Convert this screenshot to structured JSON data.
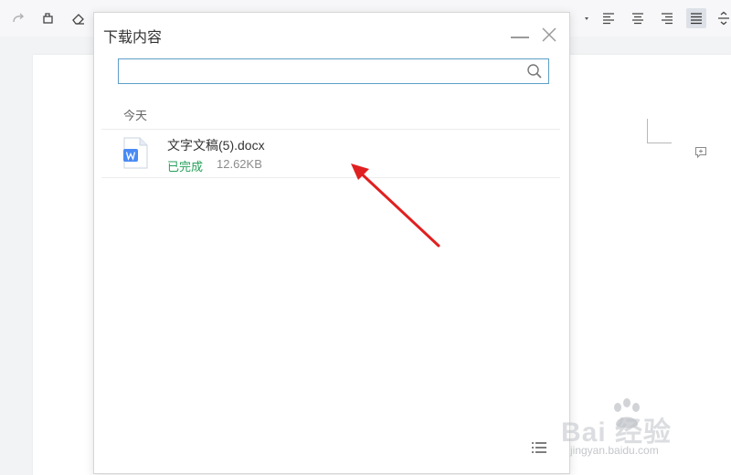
{
  "toolbar": {
    "icons": [
      "redo-icon",
      "format-painter-icon",
      "eraser-icon",
      "dropdown-arrow-icon",
      "align-left-icon",
      "align-center-icon",
      "align-right-icon",
      "justify-icon",
      "line-spacing-icon"
    ]
  },
  "dialog": {
    "title": "下载内容",
    "search": {
      "value": "",
      "placeholder": ""
    },
    "group_label": "今天",
    "files": [
      {
        "name": "文字文稿(5).docx",
        "status": "已完成",
        "size": "12.62KB"
      }
    ]
  },
  "watermark": {
    "main": "Bai  经验",
    "sub": "jingyan.baidu.com"
  },
  "colors": {
    "status_done": "#26a05a",
    "annotation_arrow": "#e02020",
    "search_border": "#5d9ec7",
    "doc_icon": "#4a8af4"
  }
}
